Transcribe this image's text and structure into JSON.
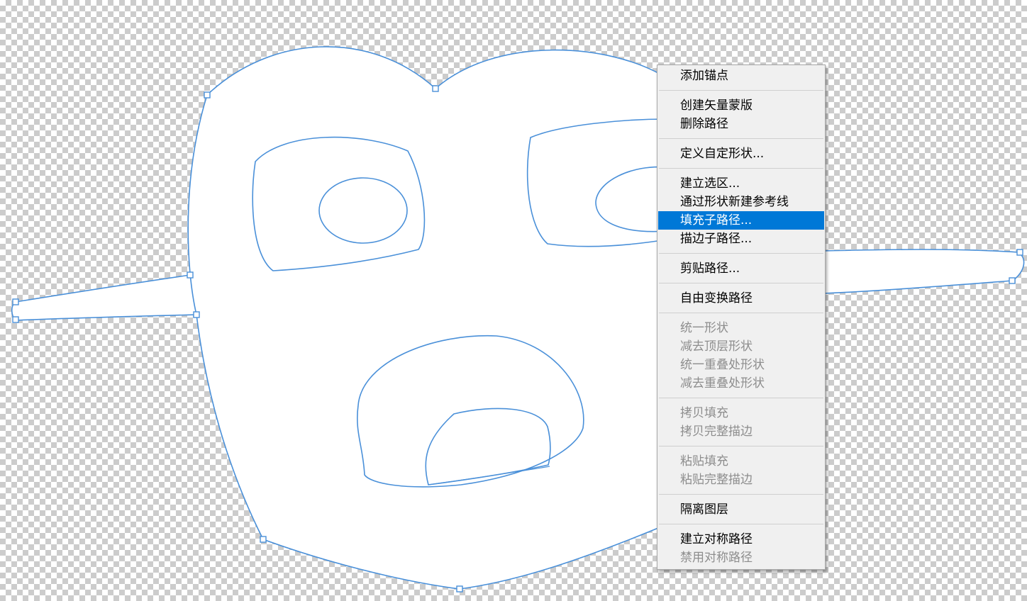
{
  "canvas": {
    "path_color": "#4a90d9",
    "shape_fill": "#ffffff"
  },
  "context_menu": {
    "groups": [
      {
        "items": [
          {
            "label": "添加锚点",
            "enabled": true
          }
        ]
      },
      {
        "items": [
          {
            "label": "创建矢量蒙版",
            "enabled": true
          },
          {
            "label": "删除路径",
            "enabled": true
          }
        ]
      },
      {
        "items": [
          {
            "label": "定义自定形状...",
            "enabled": true
          }
        ]
      },
      {
        "items": [
          {
            "label": "建立选区...",
            "enabled": true
          },
          {
            "label": "通过形状新建参考线",
            "enabled": true
          },
          {
            "label": "填充子路径...",
            "enabled": true,
            "highlighted": true
          },
          {
            "label": "描边子路径...",
            "enabled": true
          }
        ]
      },
      {
        "items": [
          {
            "label": "剪贴路径...",
            "enabled": true
          }
        ]
      },
      {
        "items": [
          {
            "label": "自由变换路径",
            "enabled": true
          }
        ]
      },
      {
        "items": [
          {
            "label": "统一形状",
            "enabled": false
          },
          {
            "label": "减去顶层形状",
            "enabled": false
          },
          {
            "label": "统一重叠处形状",
            "enabled": false
          },
          {
            "label": "减去重叠处形状",
            "enabled": false
          }
        ]
      },
      {
        "items": [
          {
            "label": "拷贝填充",
            "enabled": false
          },
          {
            "label": "拷贝完整描边",
            "enabled": false
          }
        ]
      },
      {
        "items": [
          {
            "label": "粘贴填充",
            "enabled": false
          },
          {
            "label": "粘贴完整描边",
            "enabled": false
          }
        ]
      },
      {
        "items": [
          {
            "label": "隔离图层",
            "enabled": true
          }
        ]
      },
      {
        "items": [
          {
            "label": "建立对称路径",
            "enabled": true
          },
          {
            "label": "禁用对称路径",
            "enabled": false
          }
        ]
      }
    ],
    "highlight_color": "#0078d7"
  }
}
